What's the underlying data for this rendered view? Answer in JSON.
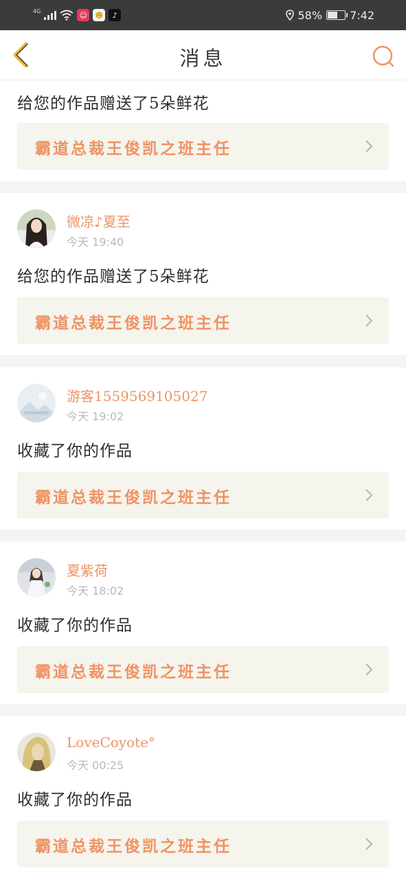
{
  "status_bar": {
    "network": "4G",
    "battery": "58%",
    "battery_level": 0.58,
    "time": "7:42"
  },
  "header": {
    "title": "消息"
  },
  "notifications": [
    {
      "message": "给您的作品赠送了5朵鲜花",
      "work_title": "霸道总裁王俊凯之班主任"
    },
    {
      "username": "微凉♪夏至",
      "time": "今天 19:40",
      "message": "给您的作品赠送了5朵鲜花",
      "work_title": "霸道总裁王俊凯之班主任"
    },
    {
      "username": "游客1559569105027",
      "time": "今天 19:02",
      "message": "收藏了你的作品",
      "work_title": "霸道总裁王俊凯之班主任"
    },
    {
      "username": "夏紫荷",
      "time": "今天 18:02",
      "message": "收藏了你的作品",
      "work_title": "霸道总裁王俊凯之班主任"
    },
    {
      "username": "LoveCoyote°",
      "time": "今天 00:25",
      "message": "收藏了你的作品",
      "work_title": "霸道总裁王俊凯之班主任"
    }
  ],
  "colors": {
    "accent": "#ef9364",
    "link_background": "#f5f4ed",
    "status_bar": "#3b3b3b",
    "back_icon": "#e9b63a"
  }
}
